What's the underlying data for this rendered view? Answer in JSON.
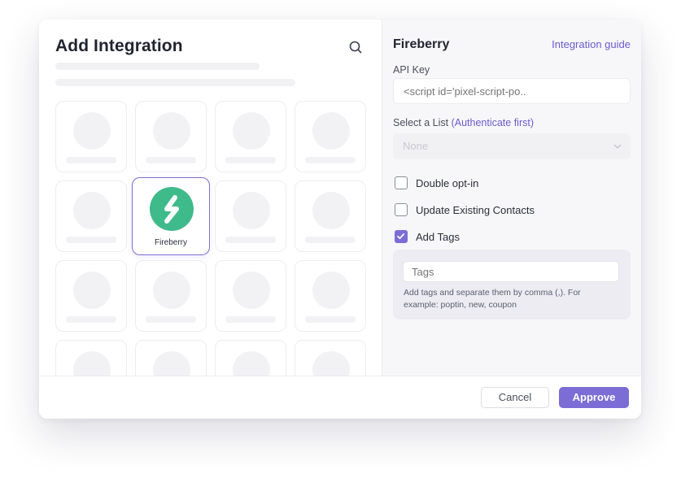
{
  "modal": {
    "title": "Add Integration",
    "search_icon": "search-icon"
  },
  "selected_integration": {
    "name": "Fireberry",
    "logo_icon": "fireberry-logo",
    "logo_color": "#3fba8a"
  },
  "details": {
    "title": "Fireberry",
    "guide_link": "Integration guide",
    "api_key_label": "API Key",
    "api_key_value": "<script id='pixel-script-po..",
    "list_label": "Select a List",
    "list_label_note": "(Authenticate first)",
    "list_value": "None",
    "checkboxes": [
      {
        "label": "Double opt-in",
        "checked": false
      },
      {
        "label": "Update Existing Contacts",
        "checked": false
      },
      {
        "label": "Add Tags",
        "checked": true
      }
    ],
    "tags_placeholder": "Tags",
    "tags_help": "Add tags and separate them by comma (,). For example: poptin, new, coupon"
  },
  "footer": {
    "cancel_label": "Cancel",
    "approve_label": "Approve"
  },
  "colors": {
    "accent": "#7c6cd6",
    "link": "#6c5bd0"
  }
}
